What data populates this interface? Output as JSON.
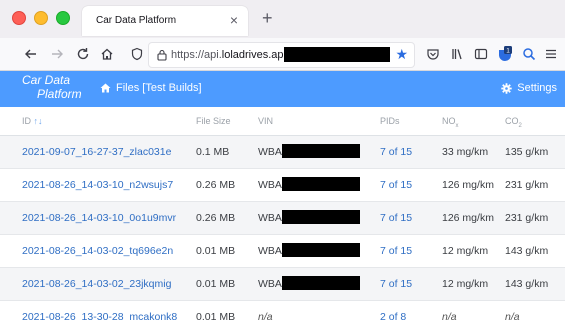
{
  "browser": {
    "tab_title": "Car Data Platform",
    "tab_close": "×",
    "new_tab": "+",
    "url_prefix": "https://api.",
    "url_domain": "loladrives.app",
    "url_suffix": "/",
    "badge_count": "1"
  },
  "app": {
    "brand_line1": "Car Data",
    "brand_line2": "Platform",
    "files_link": "Files [Test Builds]",
    "settings_link": "Settings"
  },
  "table": {
    "headers": {
      "id": "ID",
      "file_size": "File Size",
      "vin": "VIN",
      "pids": "PIDs",
      "nox": "NO",
      "nox_sub": "x",
      "co2": "CO",
      "co2_sub": "2"
    },
    "rows": [
      {
        "id": "2021-09-07_16-27-37_zlac031e",
        "size": "0.1 MB",
        "vin": "WBA",
        "pids": "7 of 15",
        "nox": "33 mg/km",
        "co2": "135 g/km"
      },
      {
        "id": "2021-08-26_14-03-10_n2wsujs7",
        "size": "0.26 MB",
        "vin": "WBA",
        "pids": "7 of 15",
        "nox": "126 mg/km",
        "co2": "231 g/km"
      },
      {
        "id": "2021-08-26_14-03-10_0o1u9mvr",
        "size": "0.26 MB",
        "vin": "WBA",
        "pids": "7 of 15",
        "nox": "126 mg/km",
        "co2": "231 g/km"
      },
      {
        "id": "2021-08-26_14-03-02_tq696e2n",
        "size": "0.01 MB",
        "vin": "WBA",
        "pids": "7 of 15",
        "nox": "12 mg/km",
        "co2": "143 g/km"
      },
      {
        "id": "2021-08-26_14-03-02_23jkqmig",
        "size": "0.01 MB",
        "vin": "WBA",
        "pids": "7 of 15",
        "nox": "12 mg/km",
        "co2": "143 g/km"
      },
      {
        "id": "2021-08-26_13-30-28_mcakonk8",
        "size": "0.01 MB",
        "vin": "n/a",
        "pids": "2 of 8",
        "nox": "n/a",
        "co2": "n/a"
      }
    ]
  },
  "colors": {
    "navbar": "#4d9bff",
    "link": "#2f6ec4",
    "accent_blue": "#2b6ce0"
  }
}
